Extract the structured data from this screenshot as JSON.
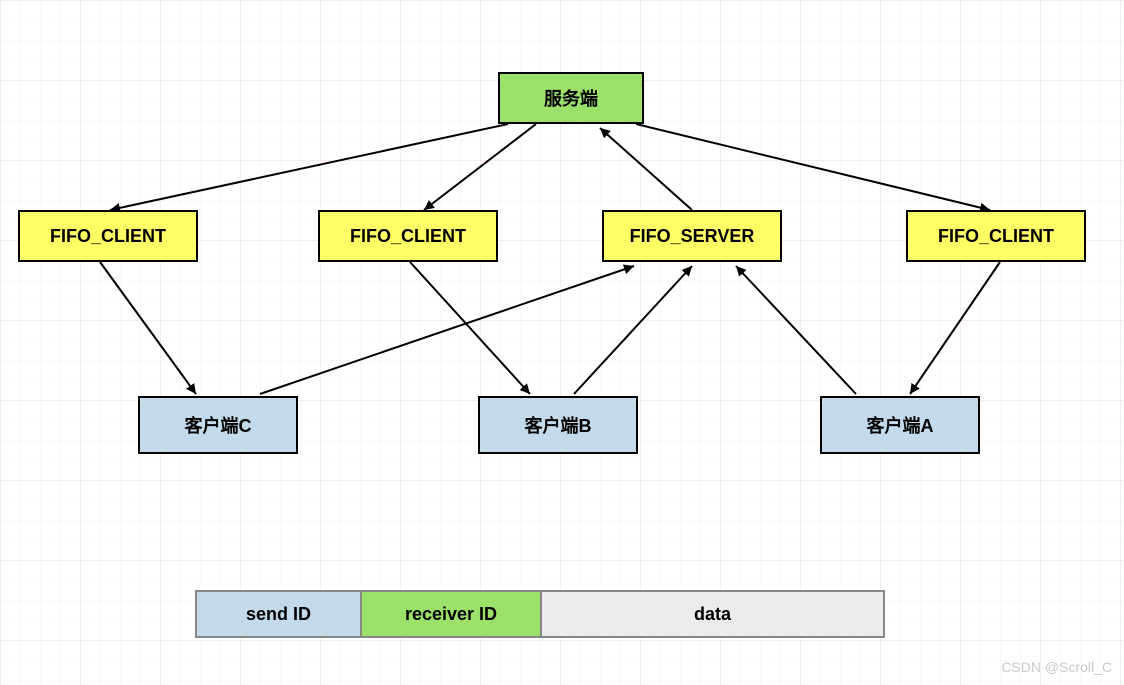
{
  "server": {
    "label": "服务端"
  },
  "fifo": {
    "client1": "FIFO_CLIENT",
    "client2": "FIFO_CLIENT",
    "server": "FIFO_SERVER",
    "client3": "FIFO_CLIENT"
  },
  "clients": {
    "c": "客户端C",
    "b": "客户端B",
    "a": "客户端A"
  },
  "legend": {
    "send": "send ID",
    "receiver": "receiver ID",
    "data": "data"
  },
  "watermark": "CSDN @Scroll_C"
}
